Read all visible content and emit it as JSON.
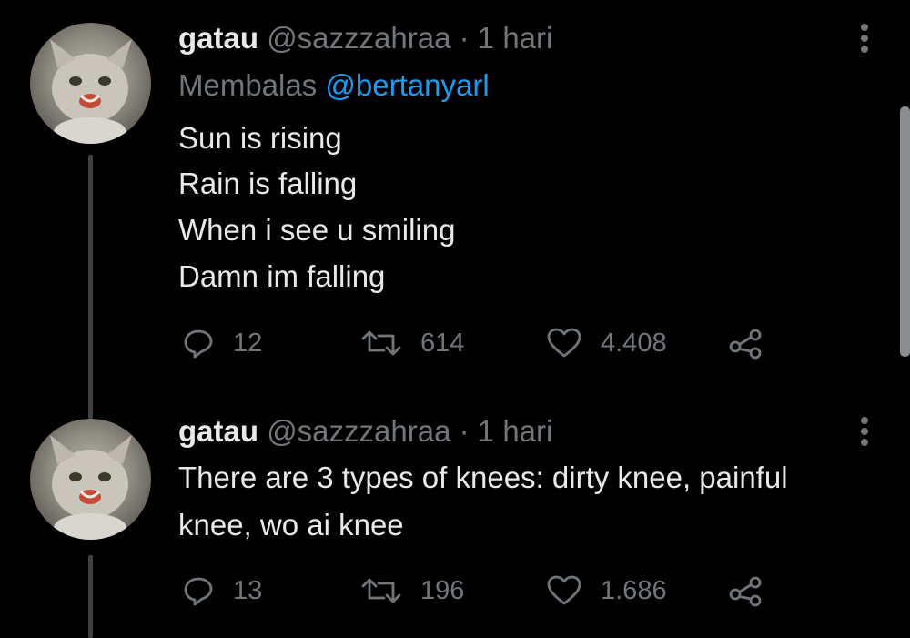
{
  "colors": {
    "background": "#000000",
    "text": "#e7e9ea",
    "secondary": "#71767b",
    "accent": "#1d9bf0",
    "thread_line": "#3e4144"
  },
  "tweets": [
    {
      "name": "gatau",
      "handle": "@sazzzahraa",
      "separator": "·",
      "time": "1 hari",
      "reply_prefix": "Membalas",
      "reply_to": "@bertanyarl",
      "lines": [
        "Sun is rising",
        "Rain is falling",
        "When i see u smiling",
        "Damn im falling"
      ],
      "replies": "12",
      "retweets": "614",
      "likes": "4.408",
      "icons": [
        "reply-icon",
        "retweet-icon",
        "like-icon",
        "share-icon",
        "more-icon"
      ]
    },
    {
      "name": "gatau",
      "handle": "@sazzzahraa",
      "separator": "·",
      "time": "1 hari",
      "lines": [
        "There are 3 types of knees: dirty knee, painful",
        "knee, wo ai knee"
      ],
      "replies": "13",
      "retweets": "196",
      "likes": "1.686",
      "icons": [
        "reply-icon",
        "retweet-icon",
        "like-icon",
        "share-icon",
        "more-icon"
      ]
    }
  ]
}
